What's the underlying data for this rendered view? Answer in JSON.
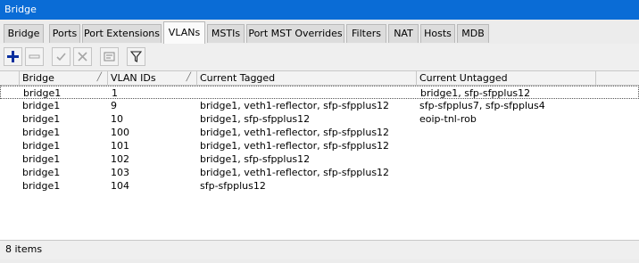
{
  "window": {
    "title": "Bridge"
  },
  "tabs": [
    {
      "label": "Bridge"
    },
    {
      "label": "Ports"
    },
    {
      "label": "Port Extensions"
    },
    {
      "label": "VLANs",
      "active": true
    },
    {
      "label": "MSTIs"
    },
    {
      "label": "Port MST Overrides"
    },
    {
      "label": "Filters"
    },
    {
      "label": "NAT"
    },
    {
      "label": "Hosts"
    },
    {
      "label": "MDB"
    }
  ],
  "toolbar": {
    "buttons": [
      {
        "name": "add-button",
        "icon": "plus-icon"
      },
      {
        "name": "remove-button",
        "icon": "minus-icon"
      },
      {
        "name": "enable-button",
        "icon": "check-icon"
      },
      {
        "name": "disable-button",
        "icon": "x-icon"
      },
      {
        "name": "comment-button",
        "icon": "note-icon"
      },
      {
        "name": "filter-button",
        "icon": "filter-icon"
      }
    ],
    "colors": {
      "add": "#0b2f9e",
      "disabled": "#a6a6a6"
    }
  },
  "table": {
    "columns": [
      {
        "label": "Bridge",
        "sortable": true
      },
      {
        "label": "VLAN IDs",
        "sortable": true
      },
      {
        "label": "Current Tagged"
      },
      {
        "label": "Current Untagged"
      }
    ],
    "rows": [
      {
        "bridge": "bridge1",
        "vlan_ids": "1",
        "tagged": "",
        "untagged": "bridge1, sfp-sfpplus12",
        "selected": true
      },
      {
        "bridge": "bridge1",
        "vlan_ids": "9",
        "tagged": "bridge1, veth1-reflector, sfp-sfpplus12",
        "untagged": "sfp-sfpplus7, sfp-sfpplus4"
      },
      {
        "bridge": "bridge1",
        "vlan_ids": "10",
        "tagged": "bridge1, sfp-sfpplus12",
        "untagged": "eoip-tnl-rob"
      },
      {
        "bridge": "bridge1",
        "vlan_ids": "100",
        "tagged": "bridge1, veth1-reflector, sfp-sfpplus12",
        "untagged": ""
      },
      {
        "bridge": "bridge1",
        "vlan_ids": "101",
        "tagged": "bridge1, veth1-reflector, sfp-sfpplus12",
        "untagged": ""
      },
      {
        "bridge": "bridge1",
        "vlan_ids": "102",
        "tagged": "bridge1, sfp-sfpplus12",
        "untagged": ""
      },
      {
        "bridge": "bridge1",
        "vlan_ids": "103",
        "tagged": "bridge1, veth1-reflector, sfp-sfpplus12",
        "untagged": ""
      },
      {
        "bridge": "bridge1",
        "vlan_ids": "104",
        "tagged": "sfp-sfpplus12",
        "untagged": ""
      }
    ]
  },
  "status": {
    "items_text": "8 items"
  }
}
